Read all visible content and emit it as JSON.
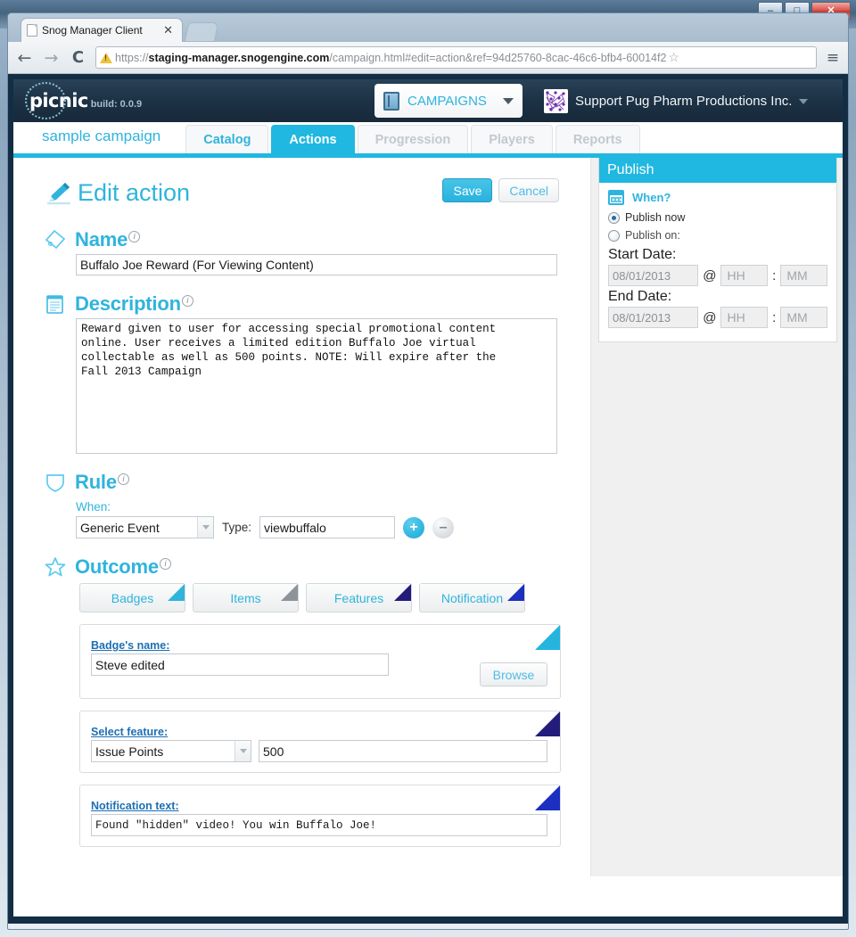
{
  "window": {
    "minimize_label": "–",
    "maximize_label": "□",
    "close_label": "✕"
  },
  "browser": {
    "tab_title": "Snog Manager Client",
    "tab_close": "✕",
    "back_icon": "←",
    "forward_icon": "→",
    "reload_icon": "C",
    "menu_icon": "≡",
    "star_icon": "☆",
    "url_scheme": "https://",
    "url_host": "staging-manager.snogengine.com",
    "url_path": "/campaign.html#edit=action&ref=94d25760-8cac-46c6-bfb4-60014f2"
  },
  "appbar": {
    "logo": "picnic",
    "build": "build: 0.0.9",
    "campaigns_label": "CAMPAIGNS",
    "account_name": "Support Pug Pharm Productions Inc."
  },
  "nav": {
    "campaign_name": "sample campaign",
    "tabs": [
      {
        "label": "Catalog",
        "state": "normal"
      },
      {
        "label": "Actions",
        "state": "active"
      },
      {
        "label": "Progression",
        "state": "disabled"
      },
      {
        "label": "Players",
        "state": "disabled"
      },
      {
        "label": "Reports",
        "state": "disabled"
      }
    ]
  },
  "page": {
    "title": "Edit action",
    "save_label": "Save",
    "cancel_label": "Cancel",
    "info_glyph": "i"
  },
  "name_section": {
    "title": "Name",
    "value": "Buffalo Joe Reward (For Viewing Content)"
  },
  "description_section": {
    "title": "Description",
    "value": "Reward given to user for accessing special promotional content\nonline. User receives a limited edition Buffalo Joe virtual\ncollectable as well as 500 points. NOTE: Will expire after the\nFall 2013 Campaign"
  },
  "rule_section": {
    "title": "Rule",
    "when_label": "When:",
    "event_value": "Generic Event",
    "type_label": "Type:",
    "type_value": "viewbuffalo",
    "add_label": "+",
    "remove_label": "–"
  },
  "outcome_section": {
    "title": "Outcome",
    "tabs": [
      {
        "label": "Badges",
        "corner_color": "#2fb4dd"
      },
      {
        "label": "Items",
        "corner_color": "#8d9399"
      },
      {
        "label": "Features",
        "corner_color": "#241c7a"
      },
      {
        "label": "Notification",
        "corner_color": "#1d2fbe"
      }
    ],
    "badge_panel": {
      "label": "Badge's name:",
      "value": "Steve edited",
      "browse_label": "Browse",
      "corner_color": "#25b4de"
    },
    "feature_panel": {
      "label": "Select feature:",
      "select_value": "Issue Points",
      "value": "500",
      "corner_color": "#241c7a"
    },
    "notification_panel": {
      "label": "Notification text:",
      "value": "Found \"hidden\" video! You win Buffalo Joe!",
      "corner_color": "#1d2fbe"
    }
  },
  "publish": {
    "title": "Publish",
    "when_label": "When?",
    "publish_now_label": "Publish now",
    "publish_on_label": "Publish on:",
    "start_date_label": "Start Date:",
    "start_date_value": "08/01/2013",
    "start_hh": "HH",
    "start_mm": "MM",
    "end_date_label": "End Date:",
    "end_date_value": "08/01/2013",
    "end_hh": "HH",
    "end_mm": "MM",
    "at_sign": "@",
    "colon": ":"
  },
  "colors": {
    "accent_cyan": "#20b8e0",
    "app_dark": "#1d3346",
    "link_blue": "#1b6fb5",
    "navy": "#241c7a"
  }
}
